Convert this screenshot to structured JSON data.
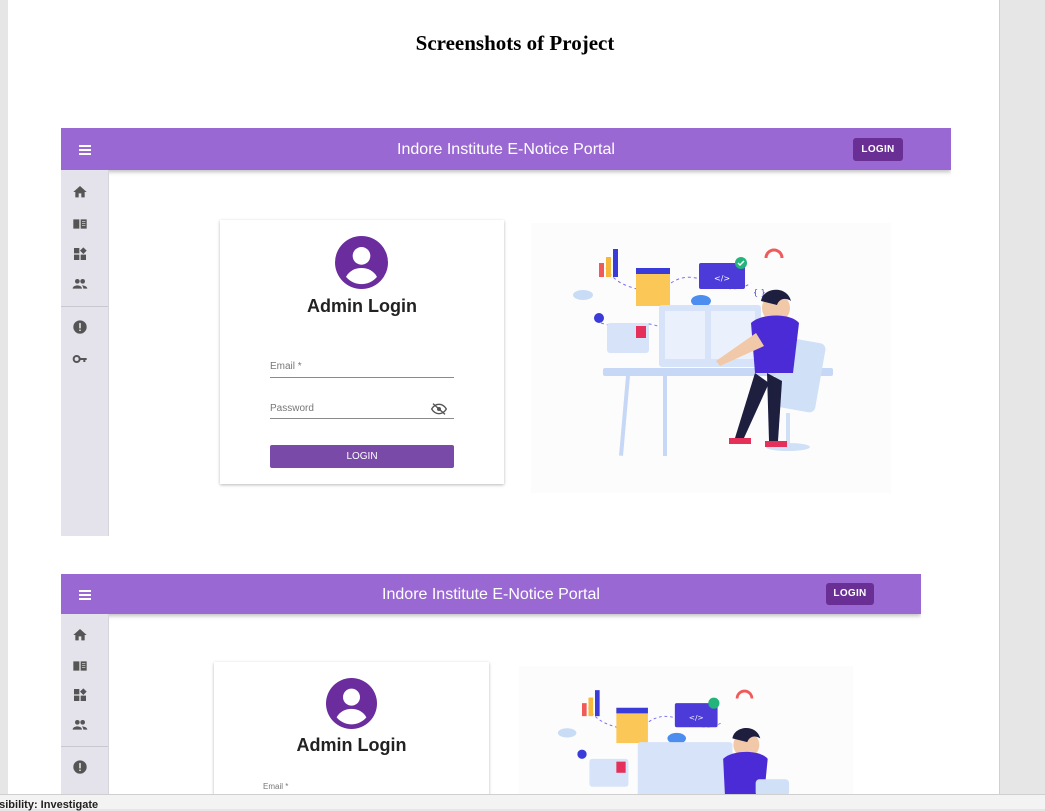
{
  "document": {
    "title": "Screenshots of Project",
    "status_text": "ssibility: Investigate"
  },
  "shots": [
    {
      "appbar_title": "Indore Institute E-Notice Portal",
      "appbar_login": "LOGIN",
      "card_title": "Admin Login",
      "email_label": "Email *",
      "password_label": "Password",
      "login_button": "LOGIN"
    },
    {
      "appbar_title": "Indore Institute E-Notice Portal",
      "appbar_login": "LOGIN",
      "card_title": "Admin Login",
      "email_label": "Email *"
    }
  ],
  "drawer_icons": [
    "home-icon",
    "book-icon",
    "dashboard-icon",
    "people-icon",
    "error-icon",
    "key-icon"
  ],
  "colors": {
    "appbar": "#9a68d2",
    "appbar_login_bg": "#6a2f94",
    "avatar": "#6b2c9e",
    "card_login_bg": "#7a4aa8",
    "drawer_bg": "#e4e2ea"
  }
}
